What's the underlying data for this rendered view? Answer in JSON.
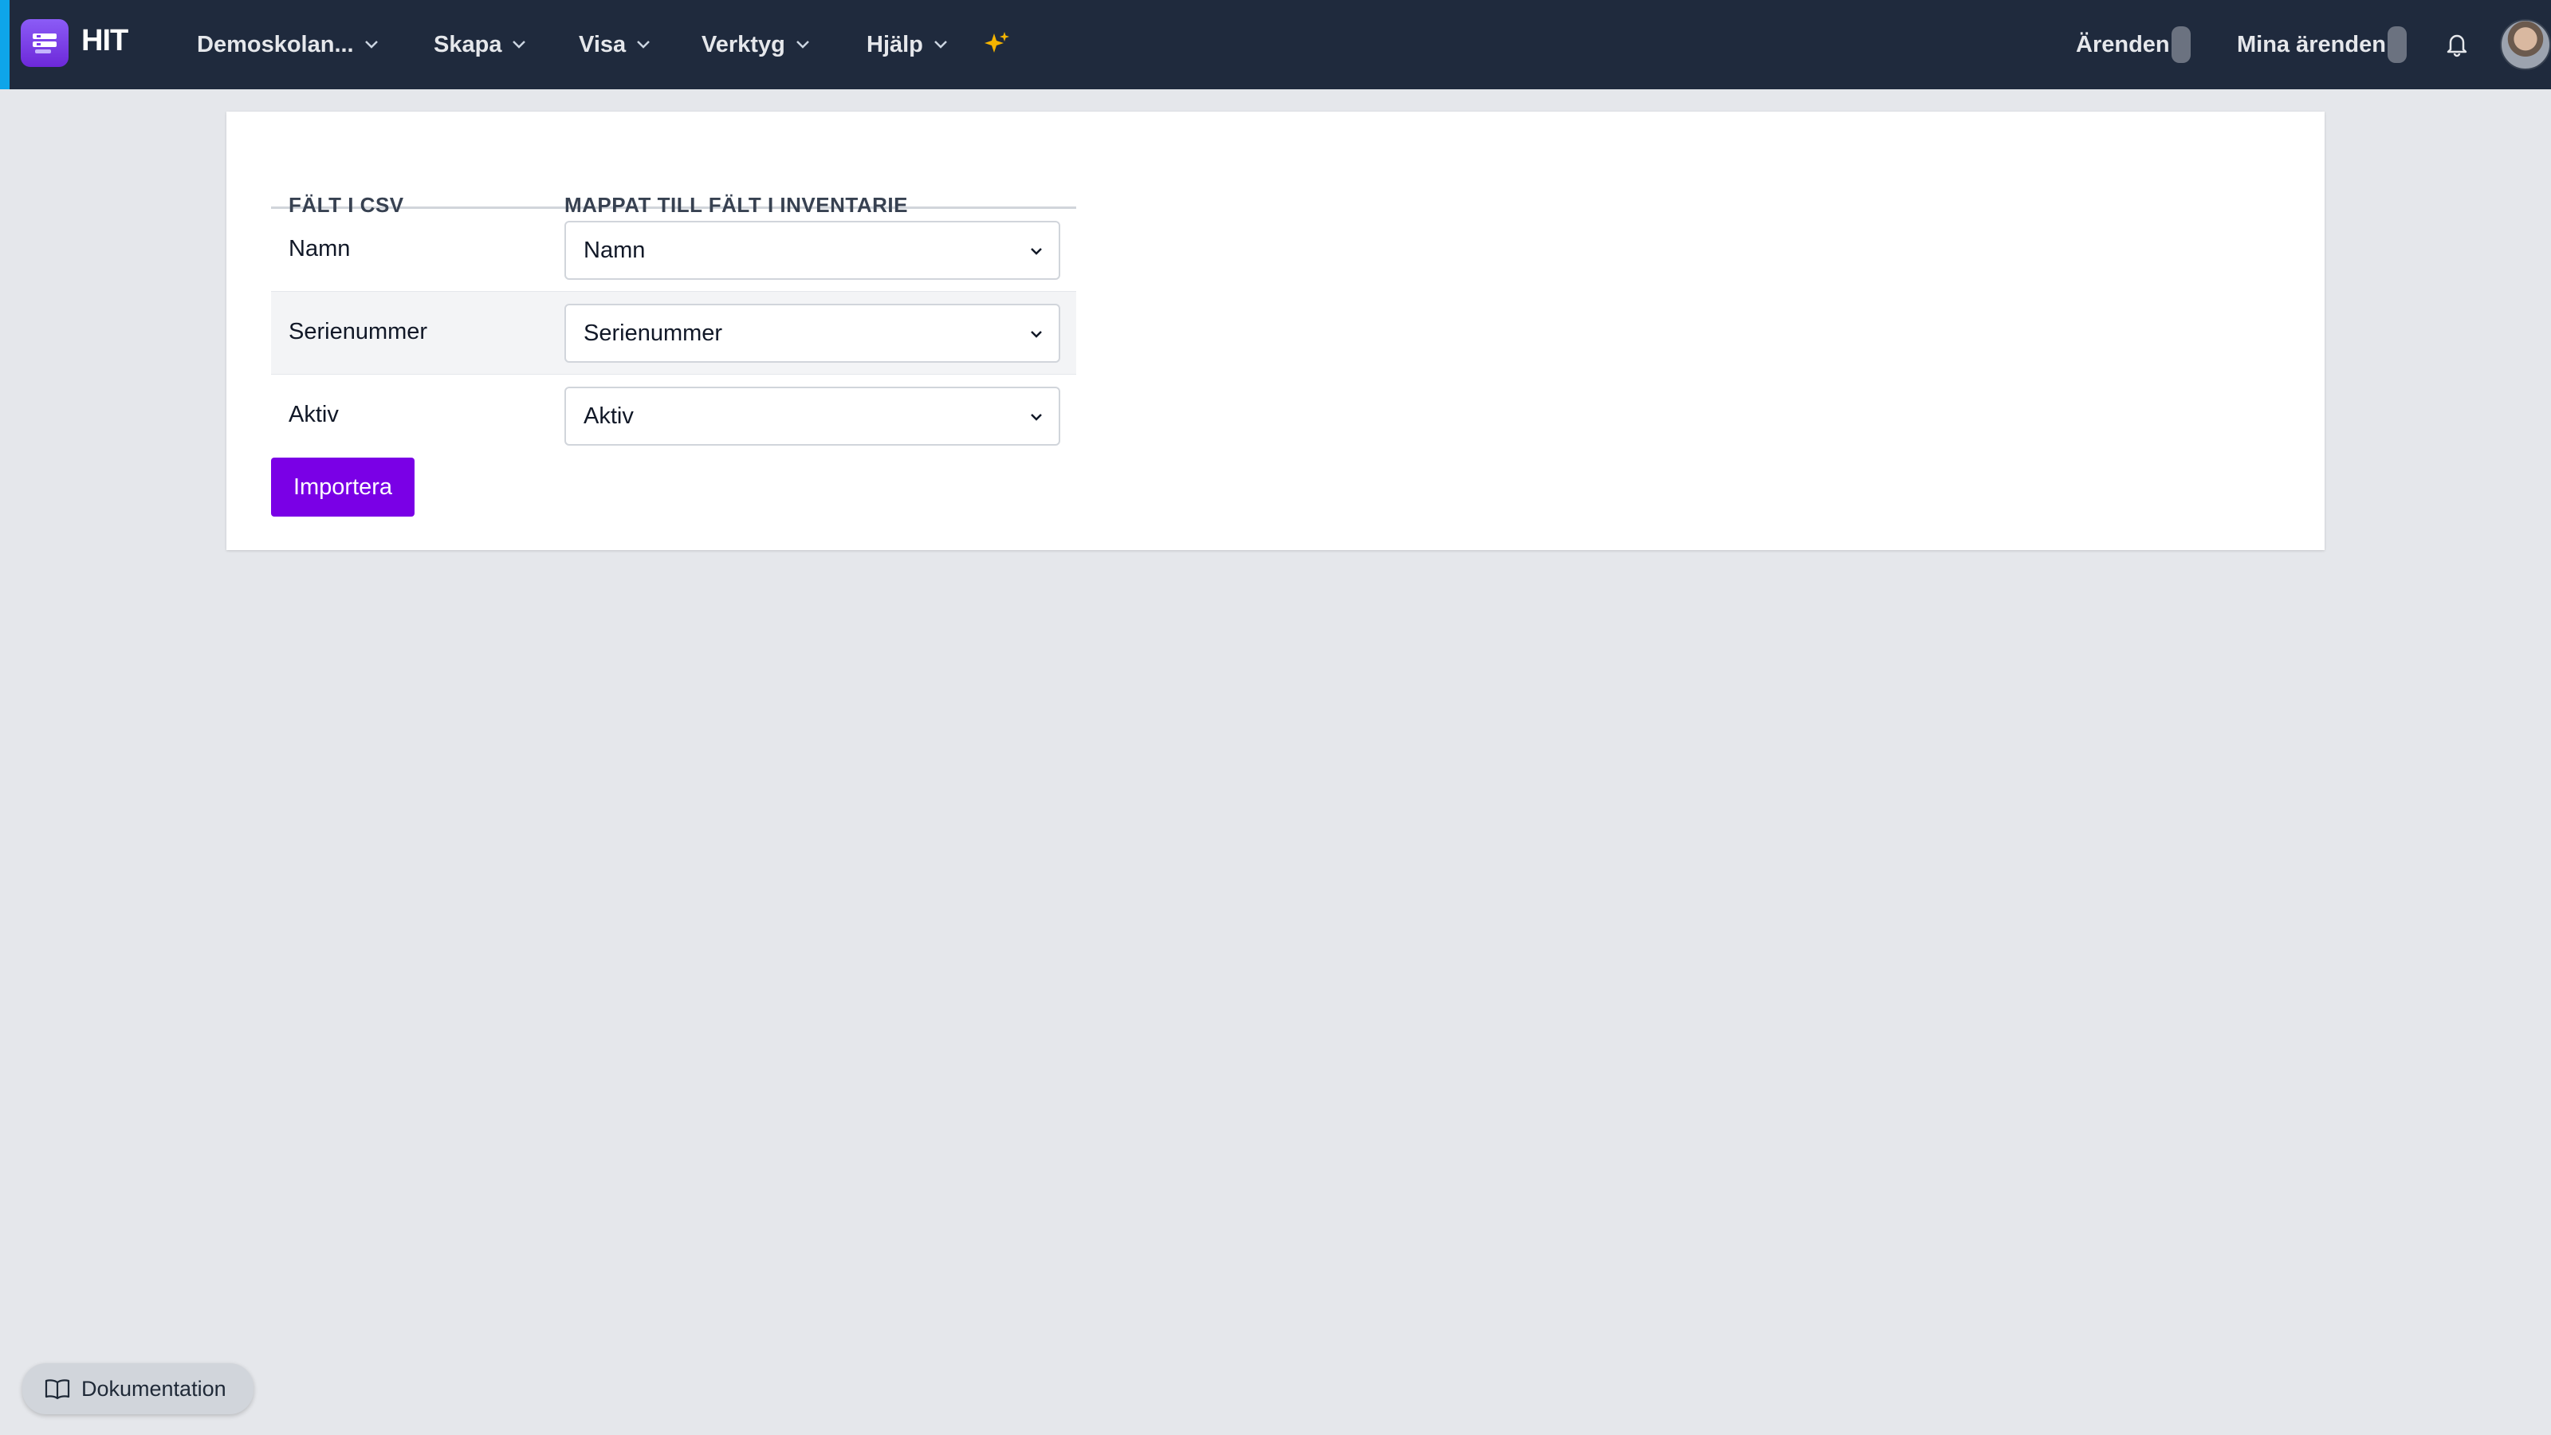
{
  "navbar": {
    "brand": "HIT",
    "menus": [
      "Demoskolan...",
      "Skapa",
      "Visa",
      "Verktyg",
      "Hjälp"
    ],
    "right": {
      "cases_label": "Ärenden",
      "my_cases_label": "Mina ärenden"
    },
    "icons": {
      "logo": "hit-logo-icon",
      "sparkle": "sparkle-icon",
      "bell": "bell-icon",
      "avatar": "user-avatar"
    },
    "colors": {
      "background": "#1f2a3d",
      "accent": "#0ea5e9",
      "sparkle": "#f5b400"
    }
  },
  "mapping": {
    "headers": {
      "csv_field": "FÄLT I CSV",
      "mapped_field": "MAPPAT TILL FÄLT I INVENTARIE"
    },
    "rows": [
      {
        "csv": "Namn",
        "mapped": "Namn"
      },
      {
        "csv": "Serienummer",
        "mapped": "Serienummer"
      },
      {
        "csv": "Aktiv",
        "mapped": "Aktiv"
      }
    ],
    "import_button": "Importera",
    "button_color": "#7a00e6"
  },
  "footer": {
    "docs_label": "Dokumentation",
    "docs_icon": "book-icon"
  }
}
